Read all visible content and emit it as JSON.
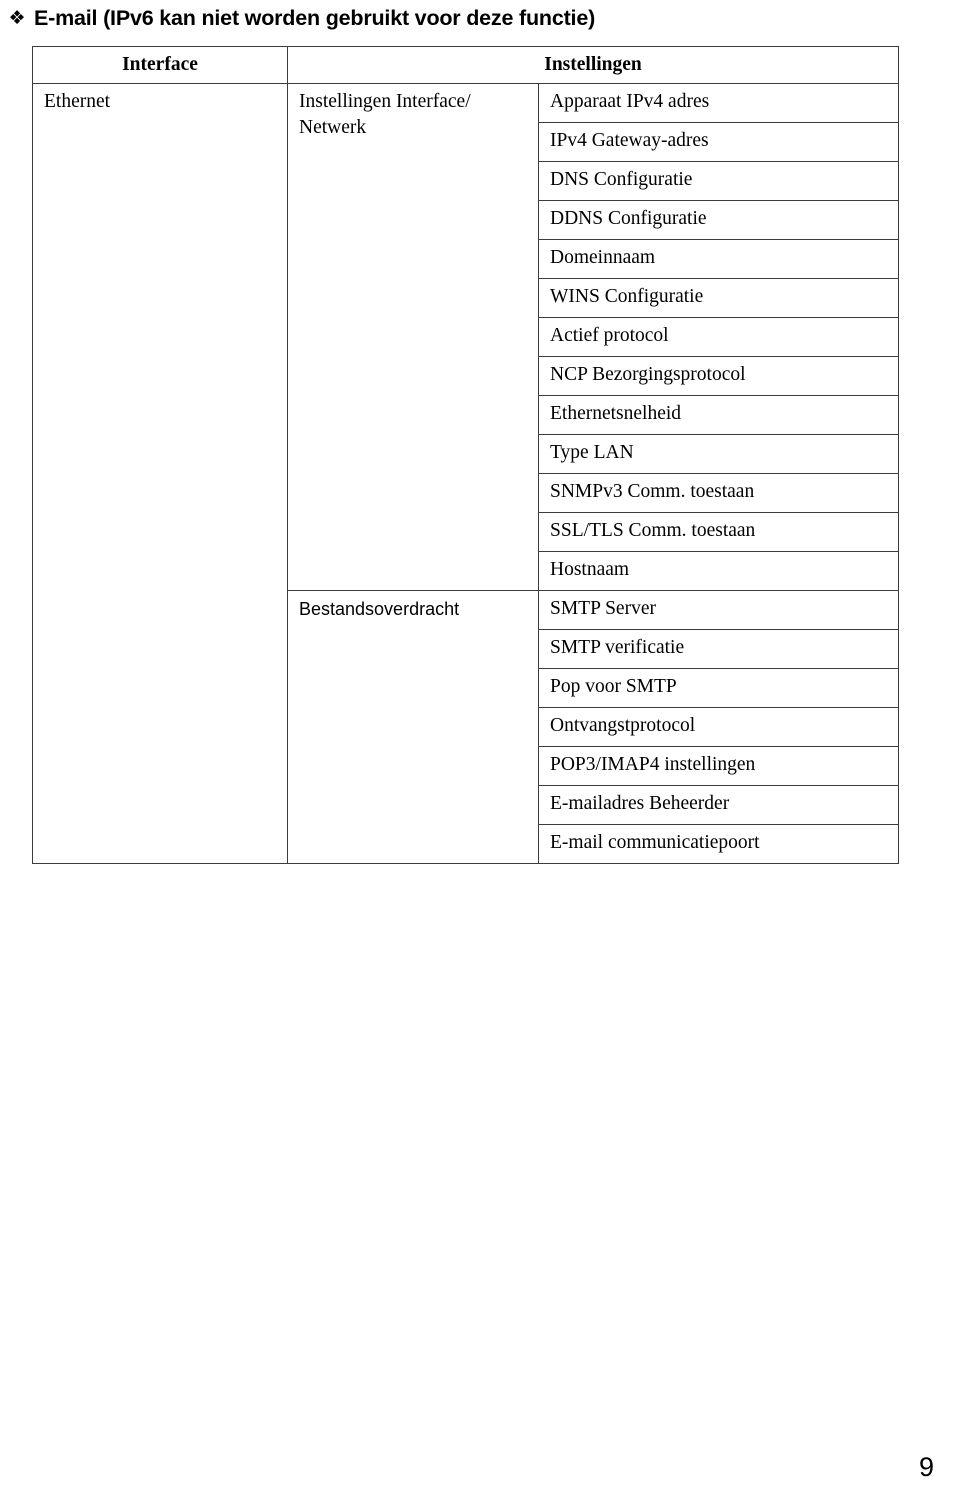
{
  "heading": {
    "bullet_icon": "diamond-cluster-bullet",
    "bullet_glyph": "❖",
    "text": "E-mail (IPv6 kan niet worden gebruikt voor deze functie)"
  },
  "table": {
    "headers": {
      "interface": "Interface",
      "settings": "Instellingen"
    },
    "interface_label": "Ethernet",
    "groups": [
      {
        "label": "Instellingen Interface/ Netwerk",
        "settings": [
          "Apparaat IPv4 adres",
          "IPv4 Gateway-adres",
          "DNS Configuratie",
          "DDNS Configuratie",
          "Domeinnaam",
          "WINS Configuratie",
          "Actief protocol",
          "NCP Bezorgingsprotocol",
          "Ethernetsnelheid",
          "Type LAN",
          "SNMPv3 Comm. toestaan",
          "SSL/TLS Comm. toestaan",
          "Hostnaam"
        ]
      },
      {
        "label": "Bestandsoverdracht",
        "settings": [
          "SMTP Server",
          "SMTP verificatie",
          "Pop voor SMTP",
          "Ontvangstprotocol",
          "POP3/IMAP4 instellingen",
          "E-mailadres Beheerder",
          "E-mail communicatiepoort"
        ]
      }
    ]
  },
  "footer": {
    "page_number": "9"
  }
}
